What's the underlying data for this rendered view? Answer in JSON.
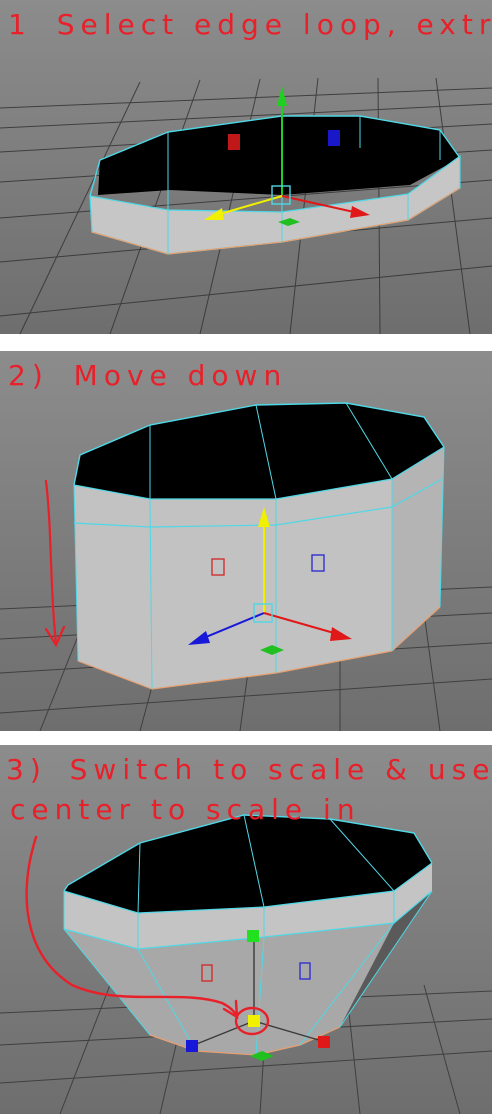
{
  "steps": [
    {
      "number": "1",
      "annotation": "Select edge loop, extrude",
      "tool": "move",
      "manipulator_handles": [
        "y-axis-green",
        "x-axis-red",
        "z-axis-yellow"
      ]
    },
    {
      "number": "2)",
      "annotation": "Move down",
      "tool": "move",
      "manipulator_handles": [
        "y-axis-yellow",
        "x-axis-red",
        "z-axis-blue"
      ]
    },
    {
      "number": "3)",
      "annotation_line1": "Switch to scale & use",
      "annotation_line2": "center to scale in",
      "tool": "scale",
      "manipulator_handles": [
        "y-axis-green",
        "center-yellow",
        "x-axis-red",
        "z-axis-blue"
      ]
    }
  ],
  "colors": {
    "viewport_bg": "#7a7a7a",
    "grid_line": "#2b2b2b",
    "wire_selected": "#4fd8e6",
    "wire_border": "#e8a070",
    "face_inner": "#000000",
    "face_outer": "#c4c4c4",
    "annotation_red": "#e8202a",
    "axis_x": "#e01818",
    "axis_y": "#20d020",
    "axis_z": "#1818d8",
    "axis_active": "#f0f000"
  }
}
